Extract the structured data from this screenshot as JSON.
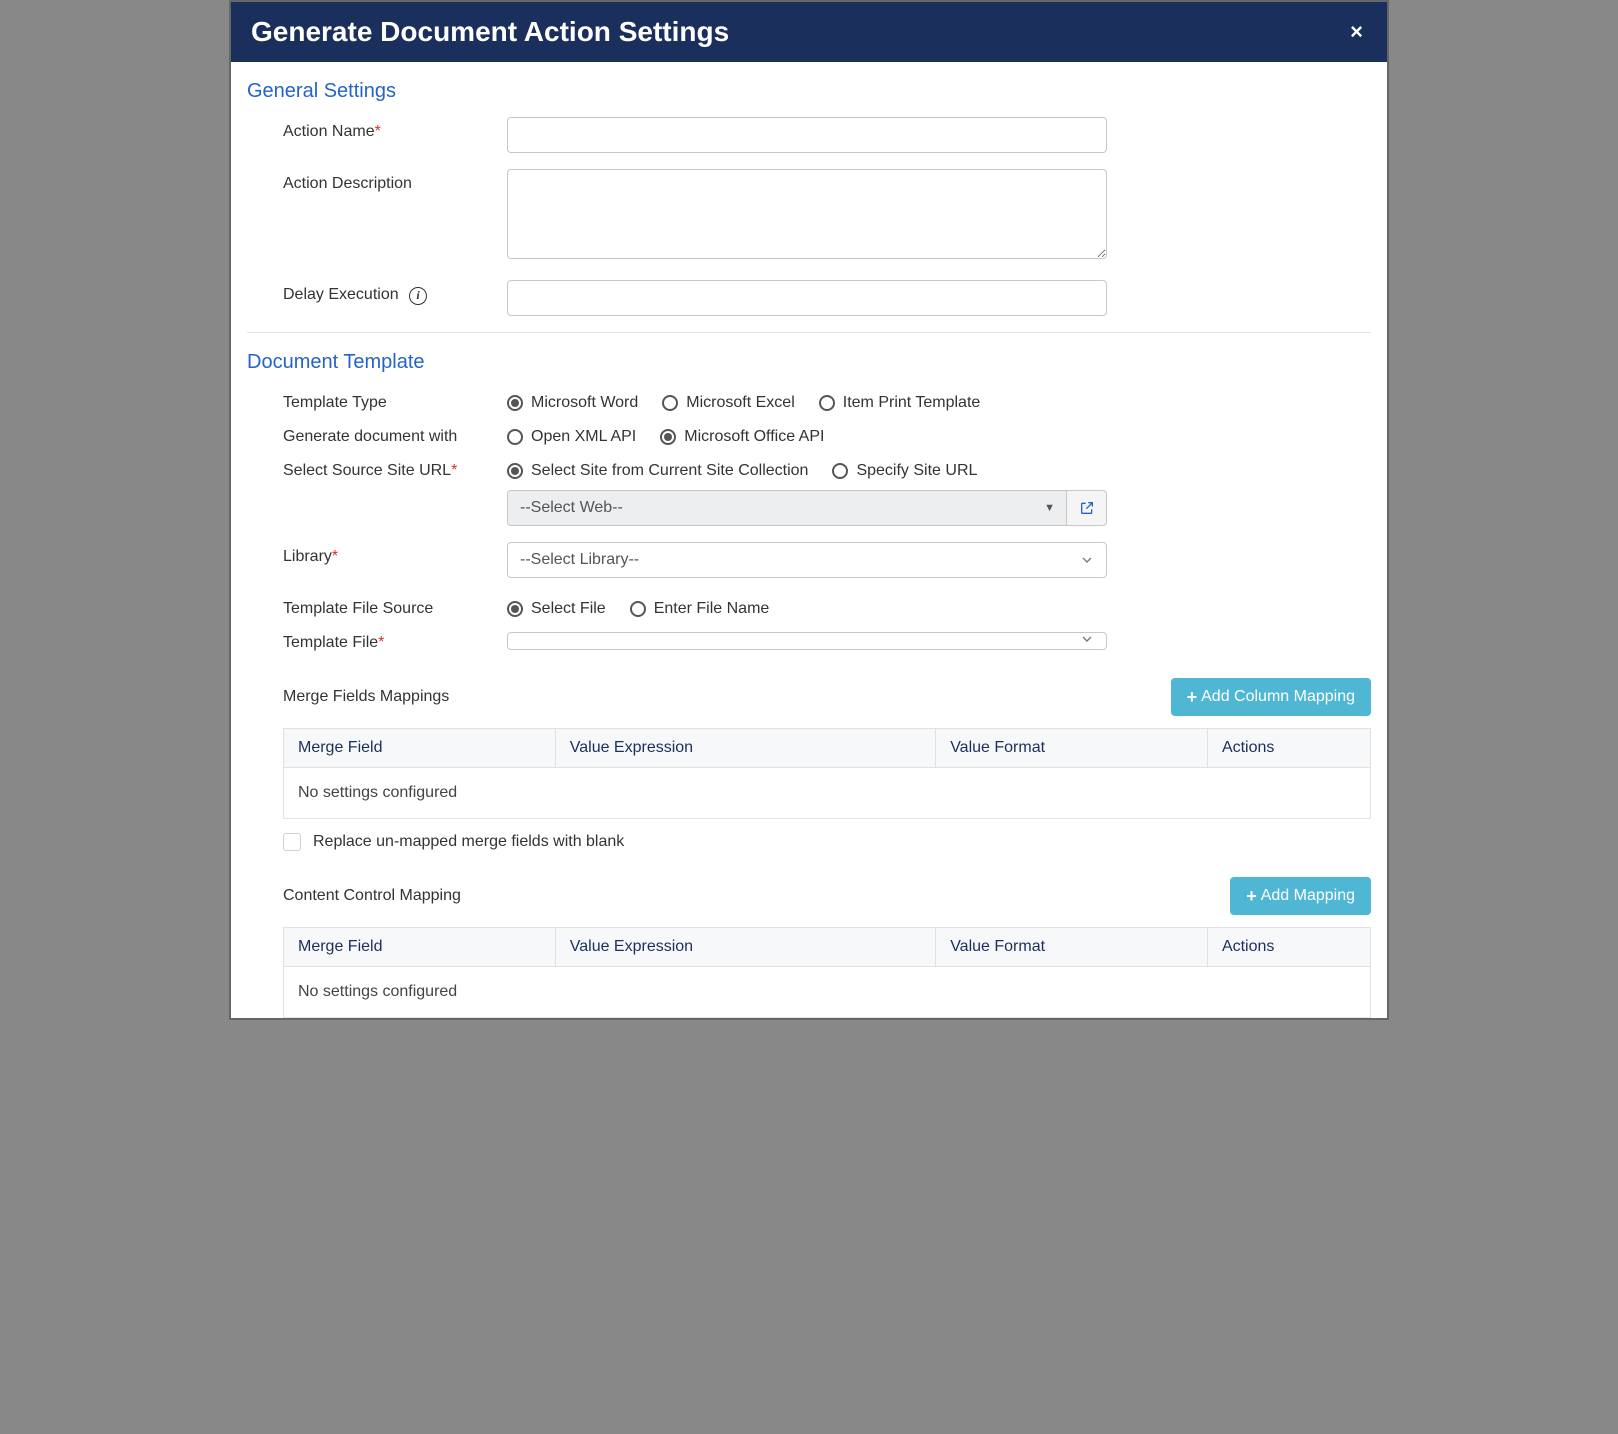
{
  "dialog": {
    "title": "Generate Document Action Settings"
  },
  "general": {
    "heading": "General Settings",
    "actionNameLabel": "Action Name",
    "actionDescLabel": "Action Description",
    "delayExecLabel": "Delay Execution",
    "actionNameValue": "",
    "actionDescValue": "",
    "delayExecValue": ""
  },
  "template": {
    "heading": "Document Template",
    "typeLabel": "Template Type",
    "typeOptions": {
      "word": "Microsoft Word",
      "excel": "Microsoft Excel",
      "print": "Item Print Template"
    },
    "generateWithLabel": "Generate document with",
    "generateOptions": {
      "openxml": "Open XML API",
      "office": "Microsoft Office API"
    },
    "sourceUrlLabel": "Select Source Site URL",
    "sourceUrlOptions": {
      "fromCollection": "Select Site from Current Site Collection",
      "specify": "Specify Site URL"
    },
    "selectWebPlaceholder": "--Select Web--",
    "libraryLabel": "Library",
    "libraryPlaceholder": "--Select Library--",
    "fileSourceLabel": "Template File Source",
    "fileSourceOptions": {
      "selectFile": "Select File",
      "enterName": "Enter File Name"
    },
    "templateFileLabel": "Template File",
    "templateFileValue": ""
  },
  "mergeMappings": {
    "title": "Merge Fields Mappings",
    "addBtn": "Add Column Mapping",
    "cols": {
      "mergeField": "Merge Field",
      "valueExpr": "Value Expression",
      "valueFmt": "Value Format",
      "actions": "Actions"
    },
    "emptyMsg": "No settings configured",
    "replaceBlankLabel": "Replace un-mapped merge fields with blank"
  },
  "contentMappings": {
    "title": "Content Control Mapping",
    "addBtn": "Add Mapping",
    "cols": {
      "mergeField": "Merge Field",
      "valueExpr": "Value Expression",
      "valueFmt": "Value Format",
      "actions": "Actions"
    },
    "emptyMsg": "No settings configured"
  }
}
